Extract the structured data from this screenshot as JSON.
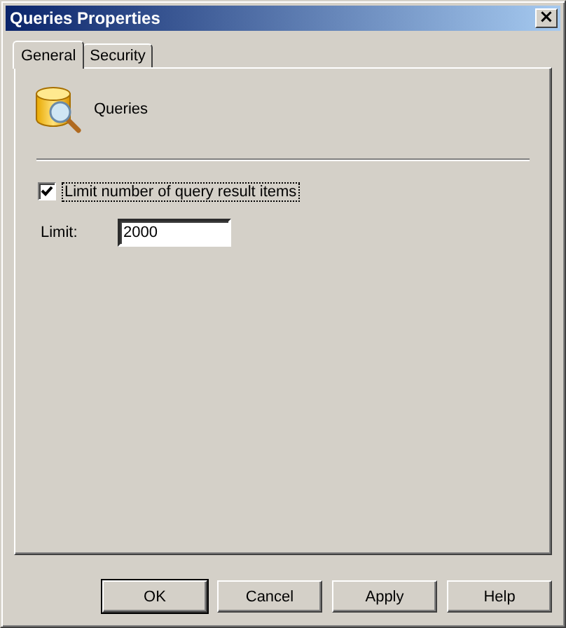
{
  "window": {
    "title": "Queries Properties",
    "close": "×"
  },
  "tabs": [
    {
      "label": "General",
      "selected": true
    },
    {
      "label": "Security",
      "selected": false
    }
  ],
  "header": {
    "name": "Queries"
  },
  "limit_checkbox": {
    "label": "Limit number of query result items",
    "checked": true,
    "focused": true
  },
  "limit_field": {
    "label": "Limit:",
    "value": "2000"
  },
  "buttons": [
    {
      "label": "OK",
      "default": true
    },
    {
      "label": "Cancel",
      "default": false
    },
    {
      "label": "Apply",
      "default": false
    },
    {
      "label": "Help",
      "default": false
    }
  ]
}
